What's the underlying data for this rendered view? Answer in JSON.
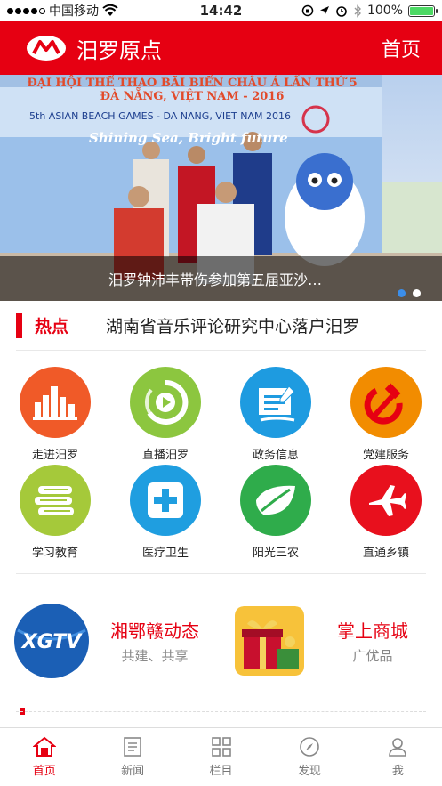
{
  "status_bar": {
    "carrier": "中国移动",
    "time": "14:42",
    "battery_text": "100%",
    "battery_level": 1.0,
    "icons": [
      "signal-dots",
      "wifi-icon",
      "location-icon",
      "alarm-icon",
      "bluetooth-icon",
      "battery-icon"
    ]
  },
  "header": {
    "app_title": "汨罗原点",
    "home_link": "首页",
    "brand_color": "#e60012"
  },
  "banner": {
    "caption": "汨罗钟沛丰带伤参加第五届亚沙…",
    "backdrop_line1": "ĐẠI HỘI THỂ THAO BÃI BIỂN CHÂU Á LẦN THỨ 5",
    "backdrop_line2": "ĐÀ NẴNG, VIỆT NAM - 2016",
    "backdrop_line3": "5th ASIAN BEACH GAMES - DA NANG, VIET NAM 2016",
    "backdrop_slogan": "Shining Sea, Bright future",
    "pager_count": 2,
    "pager_active": 0
  },
  "hot": {
    "label": "热点",
    "headline": "湖南省音乐评论研究中心落户汨罗"
  },
  "grid": [
    {
      "label": "走进汨罗",
      "icon": "city-buildings-icon",
      "color": "#f05a28"
    },
    {
      "label": "直播汨罗",
      "icon": "live-play-icon",
      "color": "#8cc63f"
    },
    {
      "label": "政务信息",
      "icon": "document-pen-icon",
      "color": "#1e9be0"
    },
    {
      "label": "党建服务",
      "icon": "hammer-sickle-icon",
      "color": "#f28c00"
    },
    {
      "label": "学习教育",
      "icon": "books-icon",
      "color": "#a5c93a"
    },
    {
      "label": "医疗卫生",
      "icon": "medical-cross-icon",
      "color": "#1f9ee0"
    },
    {
      "label": "阳光三农",
      "icon": "leaf-icon",
      "color": "#2fac4b"
    },
    {
      "label": "直通乡镇",
      "icon": "airplane-icon",
      "color": "#e8101d"
    }
  ],
  "promos": [
    {
      "title": "湘鄂赣动态",
      "subtitle": "共建、共享",
      "logo_text": "XGTV"
    },
    {
      "title": "掌上商城",
      "subtitle": "广优品",
      "image": "gift-box"
    }
  ],
  "tabbar": [
    {
      "label": "首页",
      "icon": "home-icon",
      "active": true
    },
    {
      "label": "新闻",
      "icon": "news-icon",
      "active": false
    },
    {
      "label": "栏目",
      "icon": "grid-icon",
      "active": false
    },
    {
      "label": "发现",
      "icon": "compass-icon",
      "active": false
    },
    {
      "label": "我",
      "icon": "user-icon",
      "active": false
    }
  ]
}
